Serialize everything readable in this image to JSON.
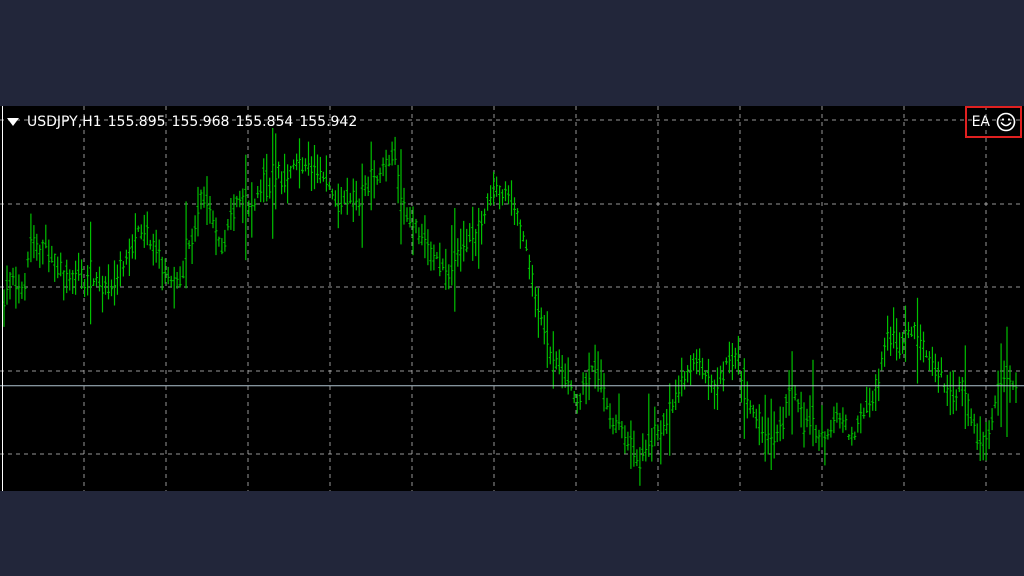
{
  "header": {
    "symbol": "USDJPY,H1",
    "open": "155.895",
    "high": "155.968",
    "low": "155.854",
    "close": "155.942"
  },
  "expert_badge": {
    "label": "EA",
    "icon": "smiley-icon",
    "highlight_color": "#e02020"
  },
  "colors": {
    "background": "#000000",
    "bars": "#00c000",
    "grid": "#c8c8c8",
    "bid_line": "#b0c4d0",
    "frame": "#22263a"
  },
  "chart_data": {
    "type": "line",
    "timeframe": "H1",
    "grid": true,
    "value_scale": "relative 0-100 (price axis not shown)",
    "current_price_level": 27,
    "series": [
      {
        "values": [
          52,
          58,
          54,
          56,
          70,
          66,
          68,
          62,
          60,
          58,
          57,
          60,
          56,
          58,
          55,
          57,
          54,
          59,
          62,
          68,
          71,
          70,
          66,
          62,
          60,
          55,
          58,
          66,
          72,
          82,
          78,
          70,
          65,
          74,
          78,
          80,
          76,
          80,
          86,
          83,
          88,
          84,
          88,
          91,
          90,
          88,
          86,
          85,
          82,
          78,
          82,
          80,
          78,
          84,
          86,
          88,
          90,
          95,
          80,
          76,
          72,
          70,
          66,
          64,
          60,
          58,
          62,
          66,
          70,
          68,
          74,
          80,
          82,
          81,
          79,
          75,
          70,
          60,
          50,
          42,
          36,
          33,
          30,
          26,
          22,
          28,
          32,
          30,
          24,
          16,
          18,
          12,
          8,
          6,
          10,
          14,
          12,
          18,
          22,
          26,
          30,
          34,
          32,
          28,
          24,
          30,
          34,
          36,
          28,
          22,
          18,
          14,
          10,
          14,
          18,
          26,
          22,
          16,
          18,
          14,
          12,
          14,
          18,
          16,
          12,
          16,
          20,
          24,
          30,
          40,
          42,
          38,
          40,
          44,
          40,
          36,
          32,
          30,
          26,
          24,
          28,
          22,
          14,
          10,
          12,
          22,
          30,
          28,
          26
        ]
      }
    ]
  }
}
